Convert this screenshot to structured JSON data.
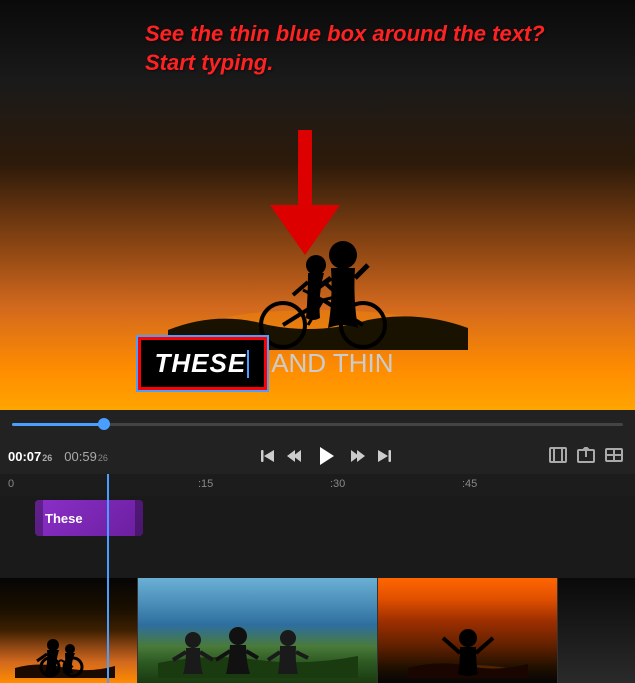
{
  "preview": {
    "instruction": {
      "line1": "See the thin blue box",
      "line2": "around the text? Start",
      "line3": "typing.",
      "full": "See the thin blue box around the text? Start typing."
    },
    "caption": {
      "selected_word": "THESE",
      "remaining": "AND THIN"
    }
  },
  "controls": {
    "time_current": "00:07",
    "time_current_super": "26",
    "time_total": "00:59",
    "time_total_super": "26",
    "btn_skip_back": "⏮",
    "btn_frame_back": "⏪",
    "btn_play": "▶",
    "btn_frame_fwd": "⏩",
    "btn_skip_fwd": "⏭"
  },
  "timeline": {
    "marks": [
      "0",
      ":15",
      ":30",
      ":45"
    ],
    "mark_positions": [
      5,
      200,
      335,
      470
    ]
  },
  "tracks": {
    "text_clip_label": "These"
  }
}
